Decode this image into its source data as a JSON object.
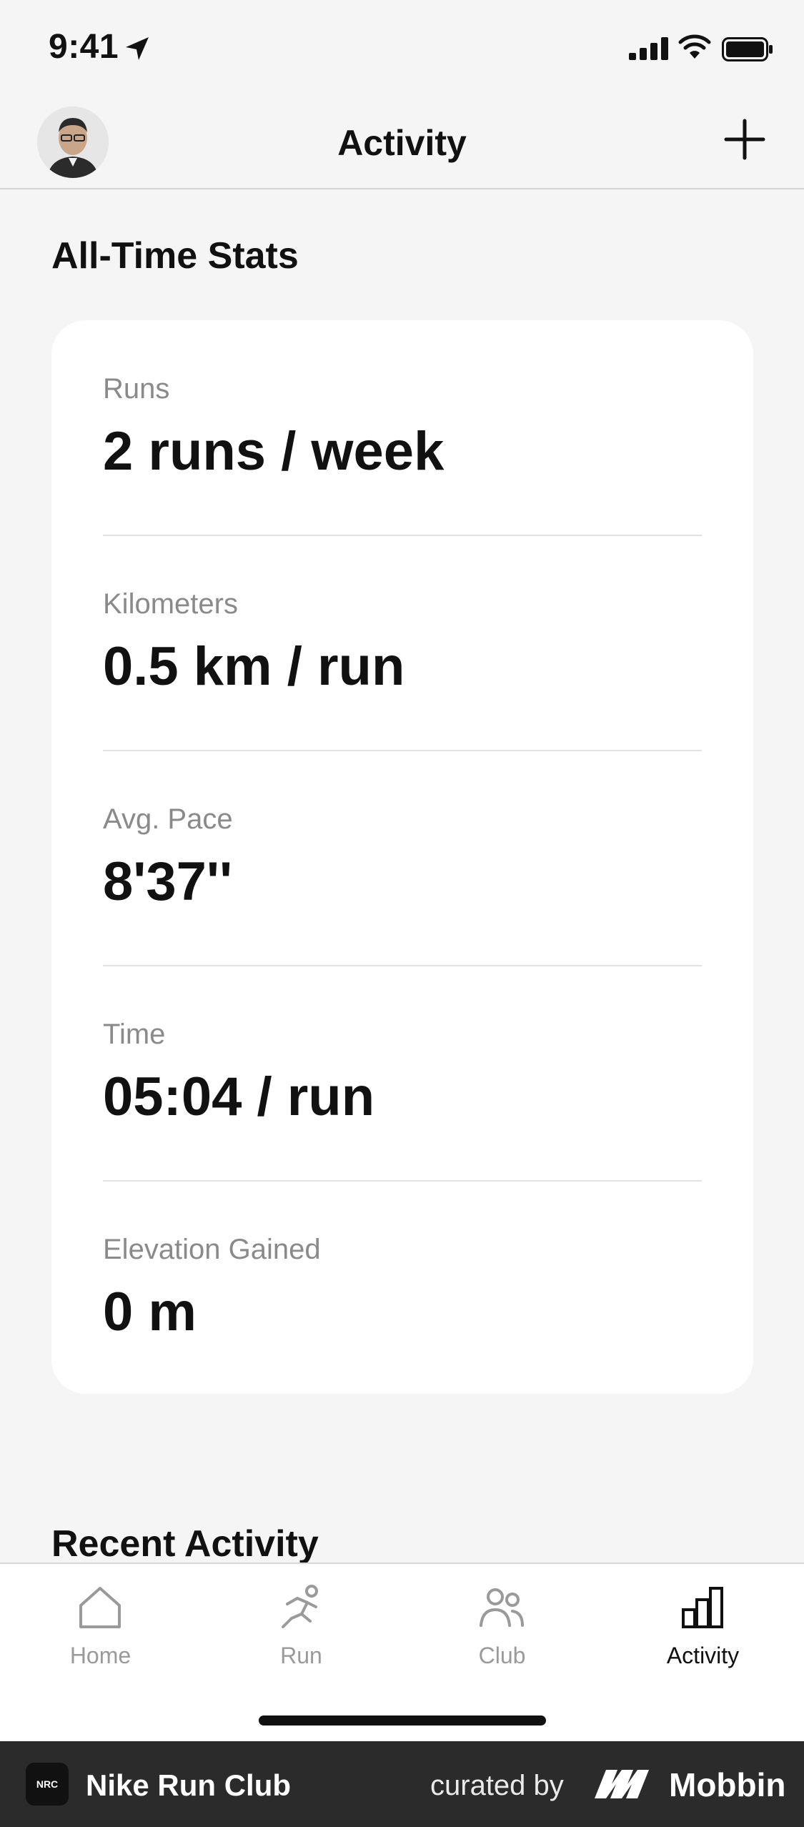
{
  "status_bar": {
    "time": "9:41",
    "icons": [
      "location-arrow-icon",
      "signal-icon",
      "wifi-icon",
      "battery-icon"
    ]
  },
  "nav": {
    "title": "Activity",
    "avatar_icon": "user-avatar",
    "action_icon": "plus-icon"
  },
  "stats": {
    "title": "All-Time Stats",
    "items": [
      {
        "label": "Runs",
        "value": "2 runs / week"
      },
      {
        "label": "Kilometers",
        "value": "0.5 km / run"
      },
      {
        "label": "Avg. Pace",
        "value": "8'37''"
      },
      {
        "label": "Time",
        "value": "05:04 / run"
      },
      {
        "label": "Elevation Gained",
        "value": "0 m"
      }
    ]
  },
  "recent": {
    "title": "Recent Activity"
  },
  "tabs": [
    {
      "label": "Home",
      "icon": "home-icon",
      "active": false
    },
    {
      "label": "Run",
      "icon": "runner-icon",
      "active": false
    },
    {
      "label": "Club",
      "icon": "people-icon",
      "active": false
    },
    {
      "label": "Activity",
      "icon": "bar-chart-icon",
      "active": true
    }
  ],
  "footer": {
    "app_name": "Nike Run Club",
    "logo_text": "NRC",
    "curated_by": "curated by",
    "brand": "Mobbin"
  },
  "colors": {
    "background": "#f5f5f5",
    "card": "#ffffff",
    "label_gray": "#8a8a8a",
    "text": "#111111",
    "footer_bg": "#2b2b2b"
  }
}
